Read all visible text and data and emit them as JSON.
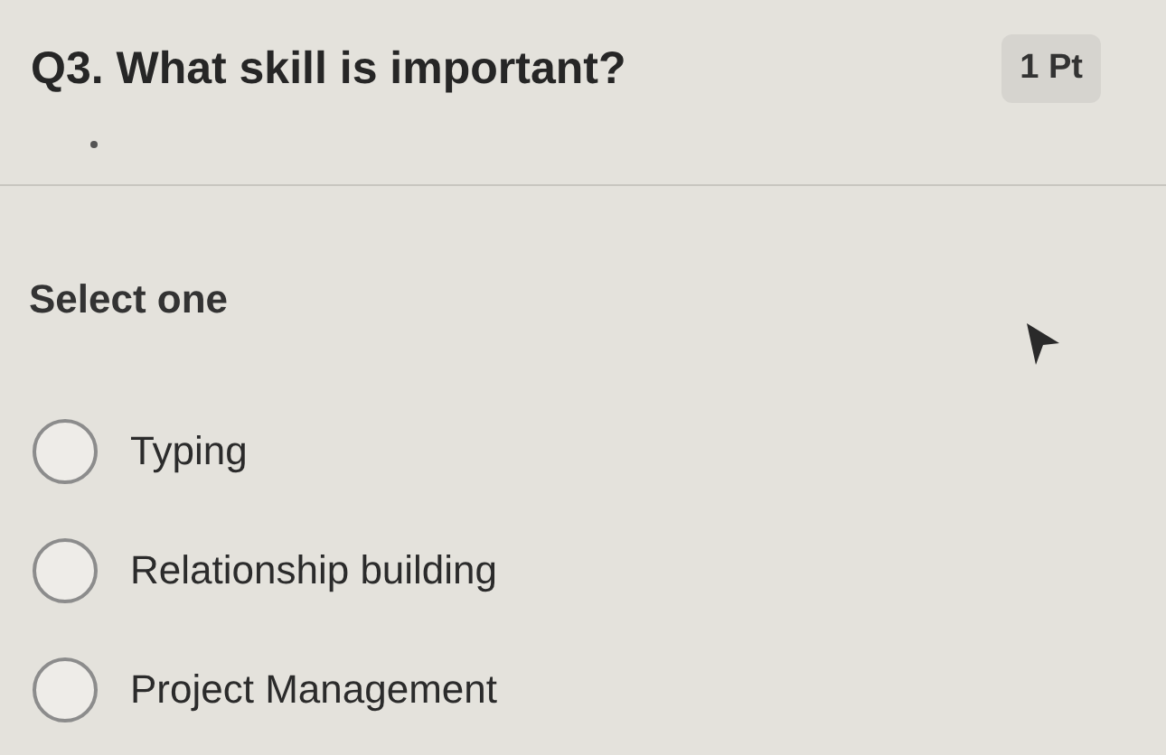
{
  "question": {
    "title": "Q3. What skill is important?",
    "points": "1 Pt"
  },
  "prompt": "Select one",
  "options": [
    {
      "label": "Typing",
      "selected": false
    },
    {
      "label": "Relationship building",
      "selected": false
    },
    {
      "label": "Project Management",
      "selected": false
    }
  ]
}
